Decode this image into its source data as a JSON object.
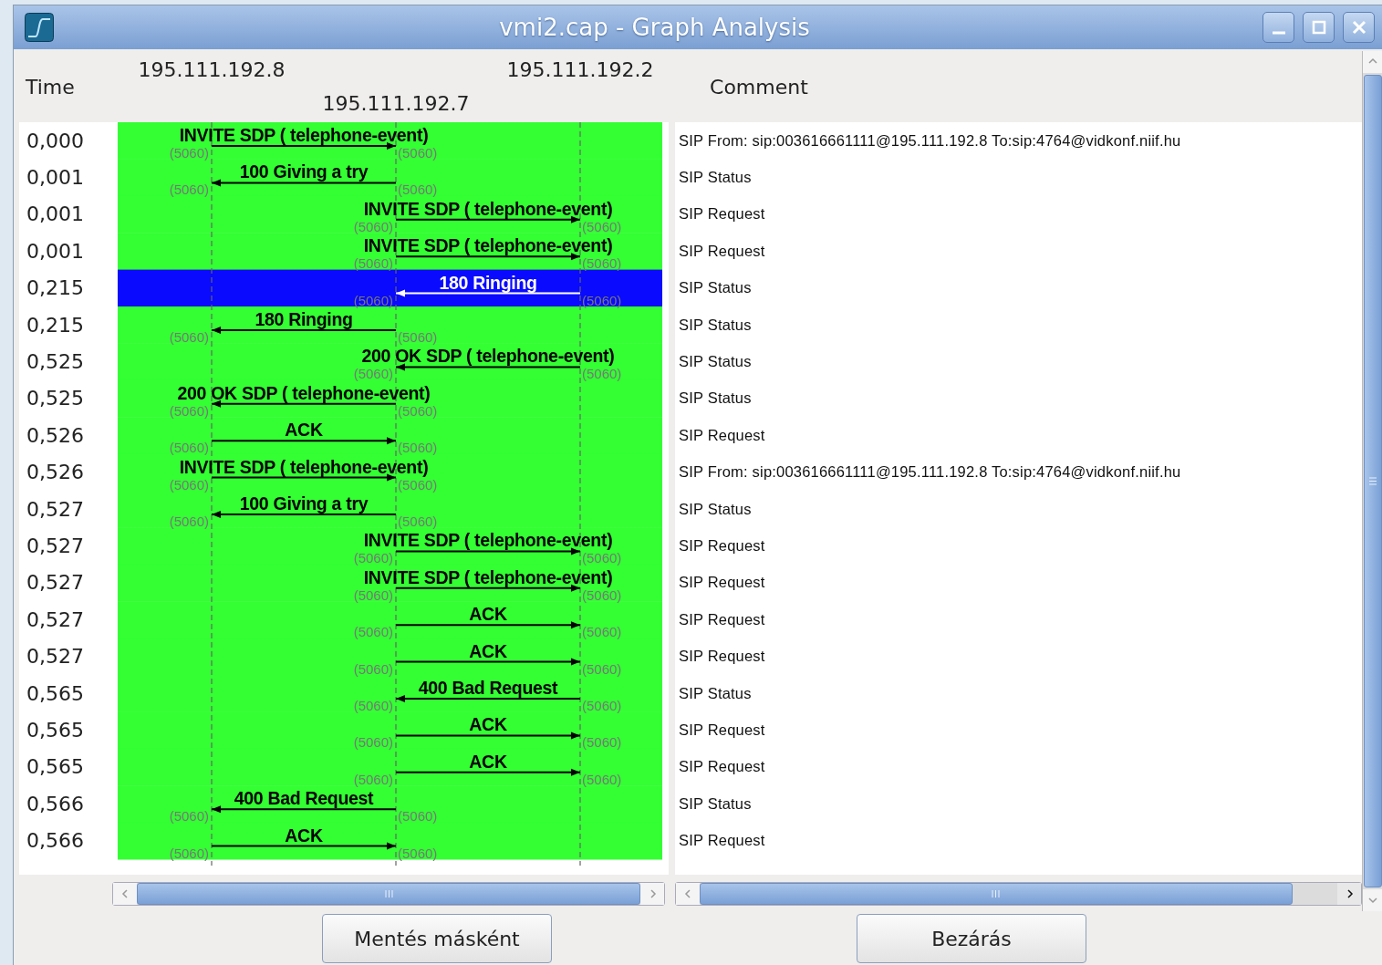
{
  "window": {
    "title": "vmi2.cap - Graph Analysis"
  },
  "graph": {
    "time_header": "Time",
    "nodes": [
      {
        "address": "195.111.192.8"
      },
      {
        "address": "195.111.192.7"
      },
      {
        "address": "195.111.192.2"
      }
    ],
    "messages": [
      {
        "time": "0,000",
        "label": "INVITE SDP ( telephone-event)",
        "kind": "l2m",
        "from_port": "(5060)",
        "to_port": "(5060)",
        "selected": false,
        "comment": "SIP From: sip:003616661111@195.111.192.8 To:sip:4764@vidkonf.niif.hu"
      },
      {
        "time": "0,001",
        "label": "100 Giving a try",
        "kind": "m2l",
        "from_port": "(5060)",
        "to_port": "(5060)",
        "selected": false,
        "comment": "SIP Status"
      },
      {
        "time": "0,001",
        "label": "INVITE SDP ( telephone-event)",
        "kind": "m2r",
        "from_port": "(5060)",
        "to_port": "(5060)",
        "selected": false,
        "comment": "SIP Request"
      },
      {
        "time": "0,001",
        "label": "INVITE SDP ( telephone-event)",
        "kind": "m2r",
        "from_port": "(5060)",
        "to_port": "(5060)",
        "selected": false,
        "comment": "SIP Request"
      },
      {
        "time": "0,215",
        "label": "180 Ringing",
        "kind": "r2m",
        "from_port": "(5060)",
        "to_port": "(5060)",
        "selected": true,
        "comment": "SIP Status"
      },
      {
        "time": "0,215",
        "label": "180 Ringing",
        "kind": "m2l",
        "from_port": "(5060)",
        "to_port": "(5060)",
        "selected": false,
        "comment": "SIP Status"
      },
      {
        "time": "0,525",
        "label": "200 OK SDP ( telephone-event)",
        "kind": "r2m",
        "from_port": "(5060)",
        "to_port": "(5060)",
        "selected": false,
        "comment": "SIP Status"
      },
      {
        "time": "0,525",
        "label": "200 OK SDP ( telephone-event)",
        "kind": "m2l",
        "from_port": "(5060)",
        "to_port": "(5060)",
        "selected": false,
        "comment": "SIP Status"
      },
      {
        "time": "0,526",
        "label": "ACK",
        "kind": "l2m",
        "from_port": "(5060)",
        "to_port": "(5060)",
        "selected": false,
        "comment": "SIP Request"
      },
      {
        "time": "0,526",
        "label": "INVITE SDP ( telephone-event)",
        "kind": "l2m",
        "from_port": "(5060)",
        "to_port": "(5060)",
        "selected": false,
        "comment": "SIP From: sip:003616661111@195.111.192.8 To:sip:4764@vidkonf.niif.hu"
      },
      {
        "time": "0,527",
        "label": "100 Giving a try",
        "kind": "m2l",
        "from_port": "(5060)",
        "to_port": "(5060)",
        "selected": false,
        "comment": "SIP Status"
      },
      {
        "time": "0,527",
        "label": "INVITE SDP ( telephone-event)",
        "kind": "m2r",
        "from_port": "(5060)",
        "to_port": "(5060)",
        "selected": false,
        "comment": "SIP Request"
      },
      {
        "time": "0,527",
        "label": "INVITE SDP ( telephone-event)",
        "kind": "m2r",
        "from_port": "(5060)",
        "to_port": "(5060)",
        "selected": false,
        "comment": "SIP Request"
      },
      {
        "time": "0,527",
        "label": "ACK",
        "kind": "m2r",
        "from_port": "(5060)",
        "to_port": "(5060)",
        "selected": false,
        "comment": "SIP Request"
      },
      {
        "time": "0,527",
        "label": "ACK",
        "kind": "m2r",
        "from_port": "(5060)",
        "to_port": "(5060)",
        "selected": false,
        "comment": "SIP Request"
      },
      {
        "time": "0,565",
        "label": "400 Bad Request",
        "kind": "r2m",
        "from_port": "(5060)",
        "to_port": "(5060)",
        "selected": false,
        "comment": "SIP Status"
      },
      {
        "time": "0,565",
        "label": "ACK",
        "kind": "m2r",
        "from_port": "(5060)",
        "to_port": "(5060)",
        "selected": false,
        "comment": "SIP Request"
      },
      {
        "time": "0,565",
        "label": "ACK",
        "kind": "m2r",
        "from_port": "(5060)",
        "to_port": "(5060)",
        "selected": false,
        "comment": "SIP Request"
      },
      {
        "time": "0,566",
        "label": "400 Bad Request",
        "kind": "m2l",
        "from_port": "(5060)",
        "to_port": "(5060)",
        "selected": false,
        "comment": "SIP Status"
      },
      {
        "time": "0,566",
        "label": "ACK",
        "kind": "l2m",
        "from_port": "(5060)",
        "to_port": "(5060)",
        "selected": false,
        "comment": "SIP Request"
      }
    ]
  },
  "comments": {
    "header": "Comment"
  },
  "buttons": [
    {
      "label": "Mentés másként"
    },
    {
      "label": "Bezárás"
    }
  ]
}
